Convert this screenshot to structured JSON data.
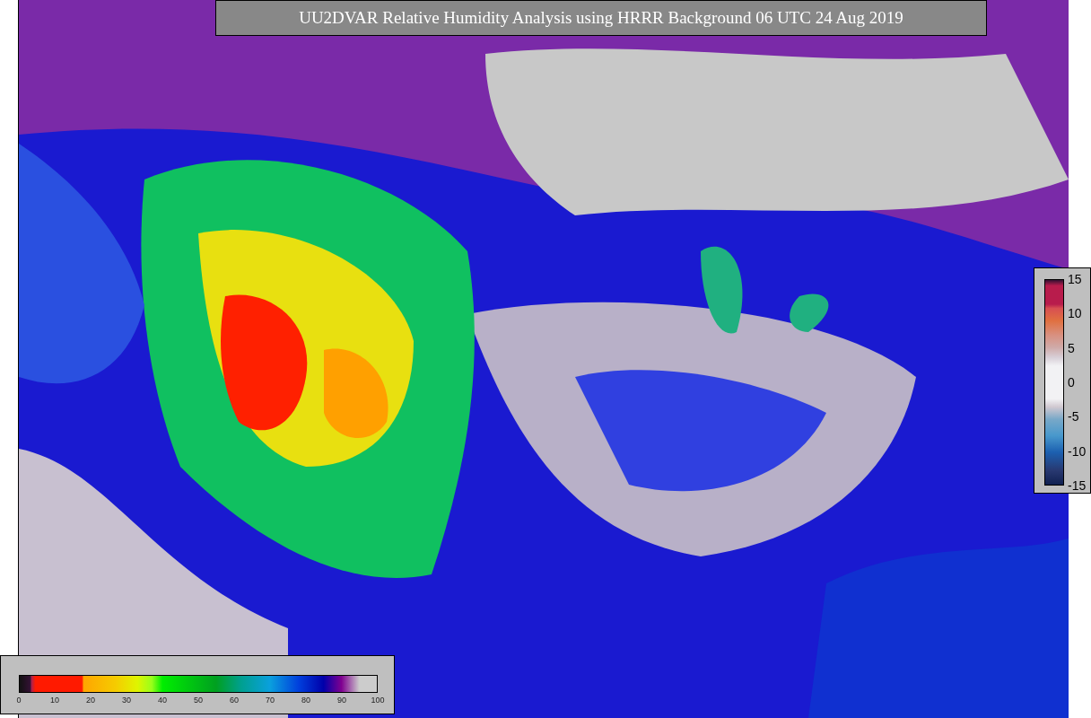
{
  "title": "UU2DVAR Relative Humidity Analysis using HRRR Background 06 UTC 24 Aug 2019",
  "humidity_colorbar": {
    "ticks": [
      "0",
      "10",
      "20",
      "30",
      "40",
      "50",
      "60",
      "70",
      "80",
      "90",
      "100"
    ]
  },
  "difference_colorbar": {
    "ticks": [
      "15",
      "10",
      "5",
      "0",
      "-5",
      "-10",
      "-15"
    ]
  }
}
